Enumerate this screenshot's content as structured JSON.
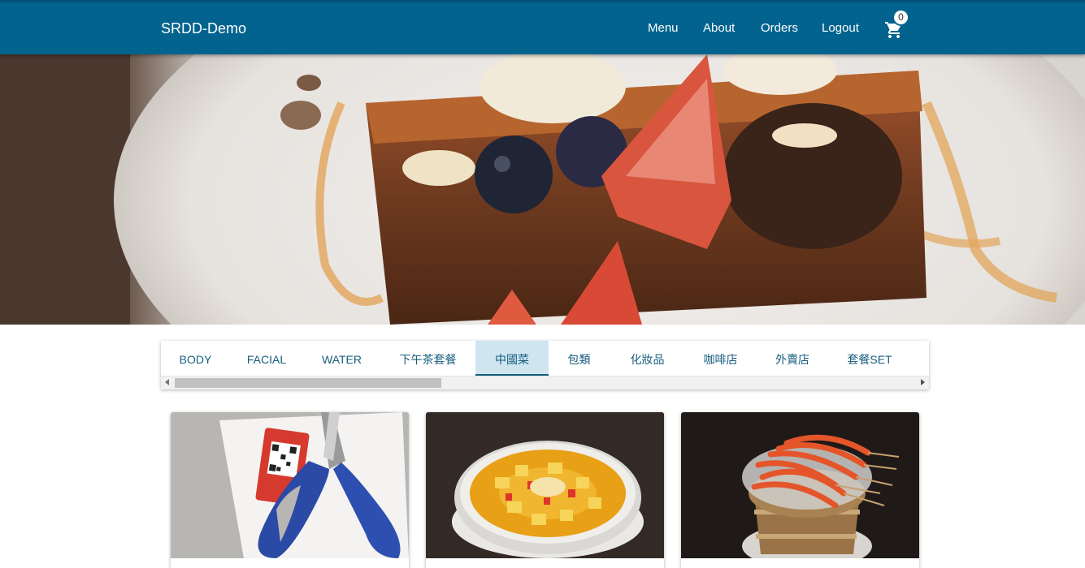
{
  "header": {
    "brand": "SRDD-Demo",
    "nav": [
      "Menu",
      "About",
      "Orders",
      "Logout"
    ],
    "cart_count": "0",
    "cart_icon": "shopping-cart-icon",
    "background": "#02638e"
  },
  "hero": {
    "image": "french-toast-dessert-photo"
  },
  "categories": {
    "tabs": [
      "BODY",
      "FACIAL",
      "WATER",
      "下午茶套餐",
      "中國菜",
      "包類",
      "化妝品",
      "咖啡店",
      "外賣店",
      "套餐SET"
    ],
    "active": "中國菜",
    "accent": "#175d7e"
  },
  "products": [
    {
      "image": "scissors-qr-code-photo"
    },
    {
      "image": "tofu-soup-bowl-photo"
    },
    {
      "image": "grilled-shrimp-skewers-photo"
    }
  ]
}
